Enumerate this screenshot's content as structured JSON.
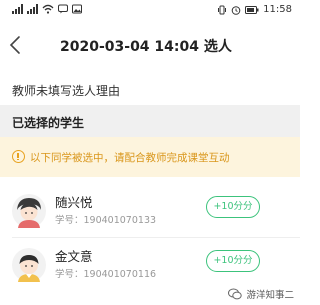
{
  "status_bar": {
    "time": "11:58",
    "icons": [
      "signal-icon",
      "signal-icon",
      "wifi-icon",
      "message-icon",
      "image-icon",
      "vibrate-icon",
      "alarm-icon",
      "battery-icon"
    ]
  },
  "nav": {
    "back_icon": "chevron-left-icon",
    "title": "2020-03-04 14:04 选人"
  },
  "reason_text": "教师未填写选人理由",
  "section_header": "已选择的学生",
  "notice": {
    "icon": "info-icon",
    "text": "以下同学被选中，请配合教师完成课堂互动"
  },
  "students": [
    {
      "name": "随兴悦",
      "id_text": "学号：190401070133",
      "score_label": "+10分分"
    },
    {
      "name": "金文意",
      "id_text": "学号：190401070116",
      "score_label": "+10分分"
    }
  ],
  "watermark": "游洋知事二",
  "colors": {
    "accent_green": "#3cc37c",
    "notice_bg": "#fdf4dd",
    "notice_text": "#d9961a",
    "section_bg": "#f0f0f0"
  }
}
